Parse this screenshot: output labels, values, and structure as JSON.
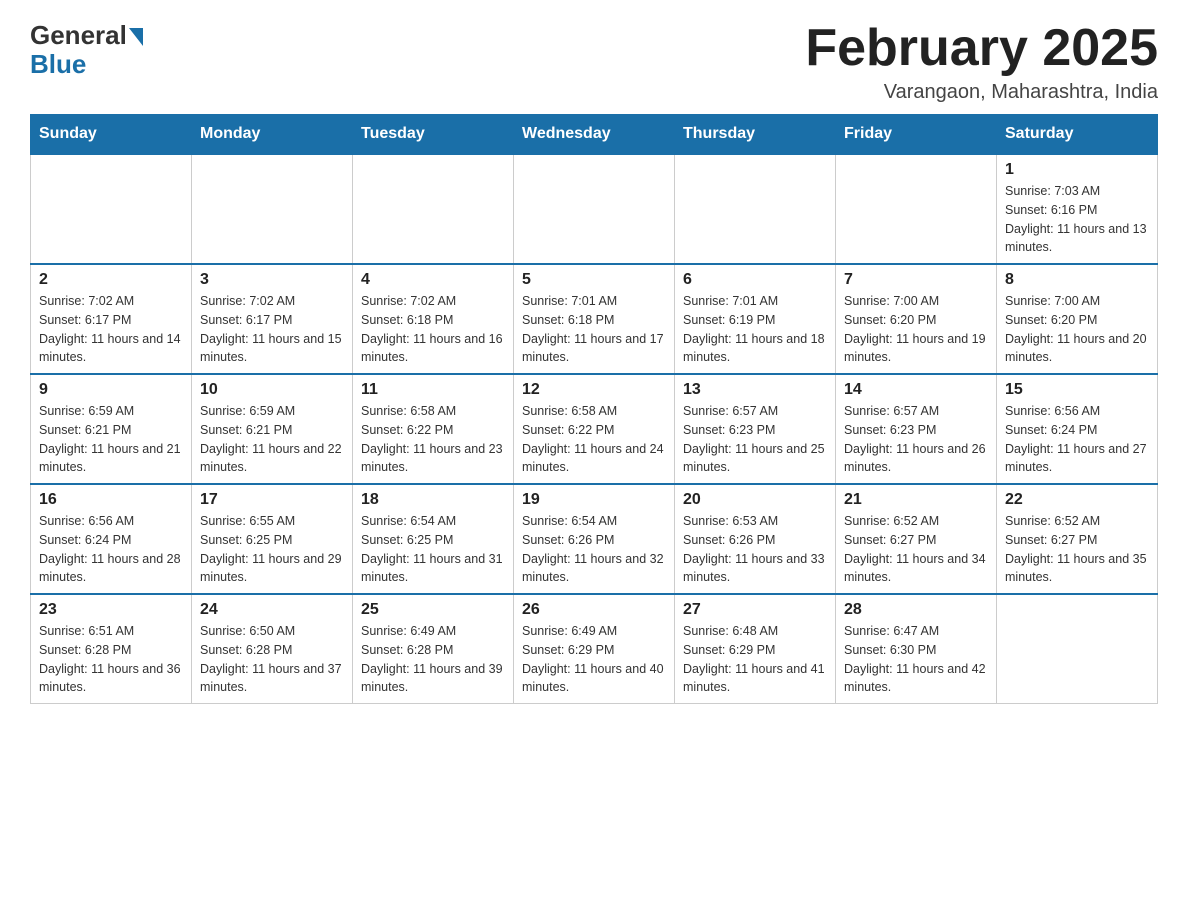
{
  "header": {
    "logo_general": "General",
    "logo_blue": "Blue",
    "month_title": "February 2025",
    "location": "Varangaon, Maharashtra, India"
  },
  "weekdays": [
    "Sunday",
    "Monday",
    "Tuesday",
    "Wednesday",
    "Thursday",
    "Friday",
    "Saturday"
  ],
  "weeks": [
    [
      {
        "day": "",
        "sunrise": "",
        "sunset": "",
        "daylight": ""
      },
      {
        "day": "",
        "sunrise": "",
        "sunset": "",
        "daylight": ""
      },
      {
        "day": "",
        "sunrise": "",
        "sunset": "",
        "daylight": ""
      },
      {
        "day": "",
        "sunrise": "",
        "sunset": "",
        "daylight": ""
      },
      {
        "day": "",
        "sunrise": "",
        "sunset": "",
        "daylight": ""
      },
      {
        "day": "",
        "sunrise": "",
        "sunset": "",
        "daylight": ""
      },
      {
        "day": "1",
        "sunrise": "Sunrise: 7:03 AM",
        "sunset": "Sunset: 6:16 PM",
        "daylight": "Daylight: 11 hours and 13 minutes."
      }
    ],
    [
      {
        "day": "2",
        "sunrise": "Sunrise: 7:02 AM",
        "sunset": "Sunset: 6:17 PM",
        "daylight": "Daylight: 11 hours and 14 minutes."
      },
      {
        "day": "3",
        "sunrise": "Sunrise: 7:02 AM",
        "sunset": "Sunset: 6:17 PM",
        "daylight": "Daylight: 11 hours and 15 minutes."
      },
      {
        "day": "4",
        "sunrise": "Sunrise: 7:02 AM",
        "sunset": "Sunset: 6:18 PM",
        "daylight": "Daylight: 11 hours and 16 minutes."
      },
      {
        "day": "5",
        "sunrise": "Sunrise: 7:01 AM",
        "sunset": "Sunset: 6:18 PM",
        "daylight": "Daylight: 11 hours and 17 minutes."
      },
      {
        "day": "6",
        "sunrise": "Sunrise: 7:01 AM",
        "sunset": "Sunset: 6:19 PM",
        "daylight": "Daylight: 11 hours and 18 minutes."
      },
      {
        "day": "7",
        "sunrise": "Sunrise: 7:00 AM",
        "sunset": "Sunset: 6:20 PM",
        "daylight": "Daylight: 11 hours and 19 minutes."
      },
      {
        "day": "8",
        "sunrise": "Sunrise: 7:00 AM",
        "sunset": "Sunset: 6:20 PM",
        "daylight": "Daylight: 11 hours and 20 minutes."
      }
    ],
    [
      {
        "day": "9",
        "sunrise": "Sunrise: 6:59 AM",
        "sunset": "Sunset: 6:21 PM",
        "daylight": "Daylight: 11 hours and 21 minutes."
      },
      {
        "day": "10",
        "sunrise": "Sunrise: 6:59 AM",
        "sunset": "Sunset: 6:21 PM",
        "daylight": "Daylight: 11 hours and 22 minutes."
      },
      {
        "day": "11",
        "sunrise": "Sunrise: 6:58 AM",
        "sunset": "Sunset: 6:22 PM",
        "daylight": "Daylight: 11 hours and 23 minutes."
      },
      {
        "day": "12",
        "sunrise": "Sunrise: 6:58 AM",
        "sunset": "Sunset: 6:22 PM",
        "daylight": "Daylight: 11 hours and 24 minutes."
      },
      {
        "day": "13",
        "sunrise": "Sunrise: 6:57 AM",
        "sunset": "Sunset: 6:23 PM",
        "daylight": "Daylight: 11 hours and 25 minutes."
      },
      {
        "day": "14",
        "sunrise": "Sunrise: 6:57 AM",
        "sunset": "Sunset: 6:23 PM",
        "daylight": "Daylight: 11 hours and 26 minutes."
      },
      {
        "day": "15",
        "sunrise": "Sunrise: 6:56 AM",
        "sunset": "Sunset: 6:24 PM",
        "daylight": "Daylight: 11 hours and 27 minutes."
      }
    ],
    [
      {
        "day": "16",
        "sunrise": "Sunrise: 6:56 AM",
        "sunset": "Sunset: 6:24 PM",
        "daylight": "Daylight: 11 hours and 28 minutes."
      },
      {
        "day": "17",
        "sunrise": "Sunrise: 6:55 AM",
        "sunset": "Sunset: 6:25 PM",
        "daylight": "Daylight: 11 hours and 29 minutes."
      },
      {
        "day": "18",
        "sunrise": "Sunrise: 6:54 AM",
        "sunset": "Sunset: 6:25 PM",
        "daylight": "Daylight: 11 hours and 31 minutes."
      },
      {
        "day": "19",
        "sunrise": "Sunrise: 6:54 AM",
        "sunset": "Sunset: 6:26 PM",
        "daylight": "Daylight: 11 hours and 32 minutes."
      },
      {
        "day": "20",
        "sunrise": "Sunrise: 6:53 AM",
        "sunset": "Sunset: 6:26 PM",
        "daylight": "Daylight: 11 hours and 33 minutes."
      },
      {
        "day": "21",
        "sunrise": "Sunrise: 6:52 AM",
        "sunset": "Sunset: 6:27 PM",
        "daylight": "Daylight: 11 hours and 34 minutes."
      },
      {
        "day": "22",
        "sunrise": "Sunrise: 6:52 AM",
        "sunset": "Sunset: 6:27 PM",
        "daylight": "Daylight: 11 hours and 35 minutes."
      }
    ],
    [
      {
        "day": "23",
        "sunrise": "Sunrise: 6:51 AM",
        "sunset": "Sunset: 6:28 PM",
        "daylight": "Daylight: 11 hours and 36 minutes."
      },
      {
        "day": "24",
        "sunrise": "Sunrise: 6:50 AM",
        "sunset": "Sunset: 6:28 PM",
        "daylight": "Daylight: 11 hours and 37 minutes."
      },
      {
        "day": "25",
        "sunrise": "Sunrise: 6:49 AM",
        "sunset": "Sunset: 6:28 PM",
        "daylight": "Daylight: 11 hours and 39 minutes."
      },
      {
        "day": "26",
        "sunrise": "Sunrise: 6:49 AM",
        "sunset": "Sunset: 6:29 PM",
        "daylight": "Daylight: 11 hours and 40 minutes."
      },
      {
        "day": "27",
        "sunrise": "Sunrise: 6:48 AM",
        "sunset": "Sunset: 6:29 PM",
        "daylight": "Daylight: 11 hours and 41 minutes."
      },
      {
        "day": "28",
        "sunrise": "Sunrise: 6:47 AM",
        "sunset": "Sunset: 6:30 PM",
        "daylight": "Daylight: 11 hours and 42 minutes."
      },
      {
        "day": "",
        "sunrise": "",
        "sunset": "",
        "daylight": ""
      }
    ]
  ]
}
